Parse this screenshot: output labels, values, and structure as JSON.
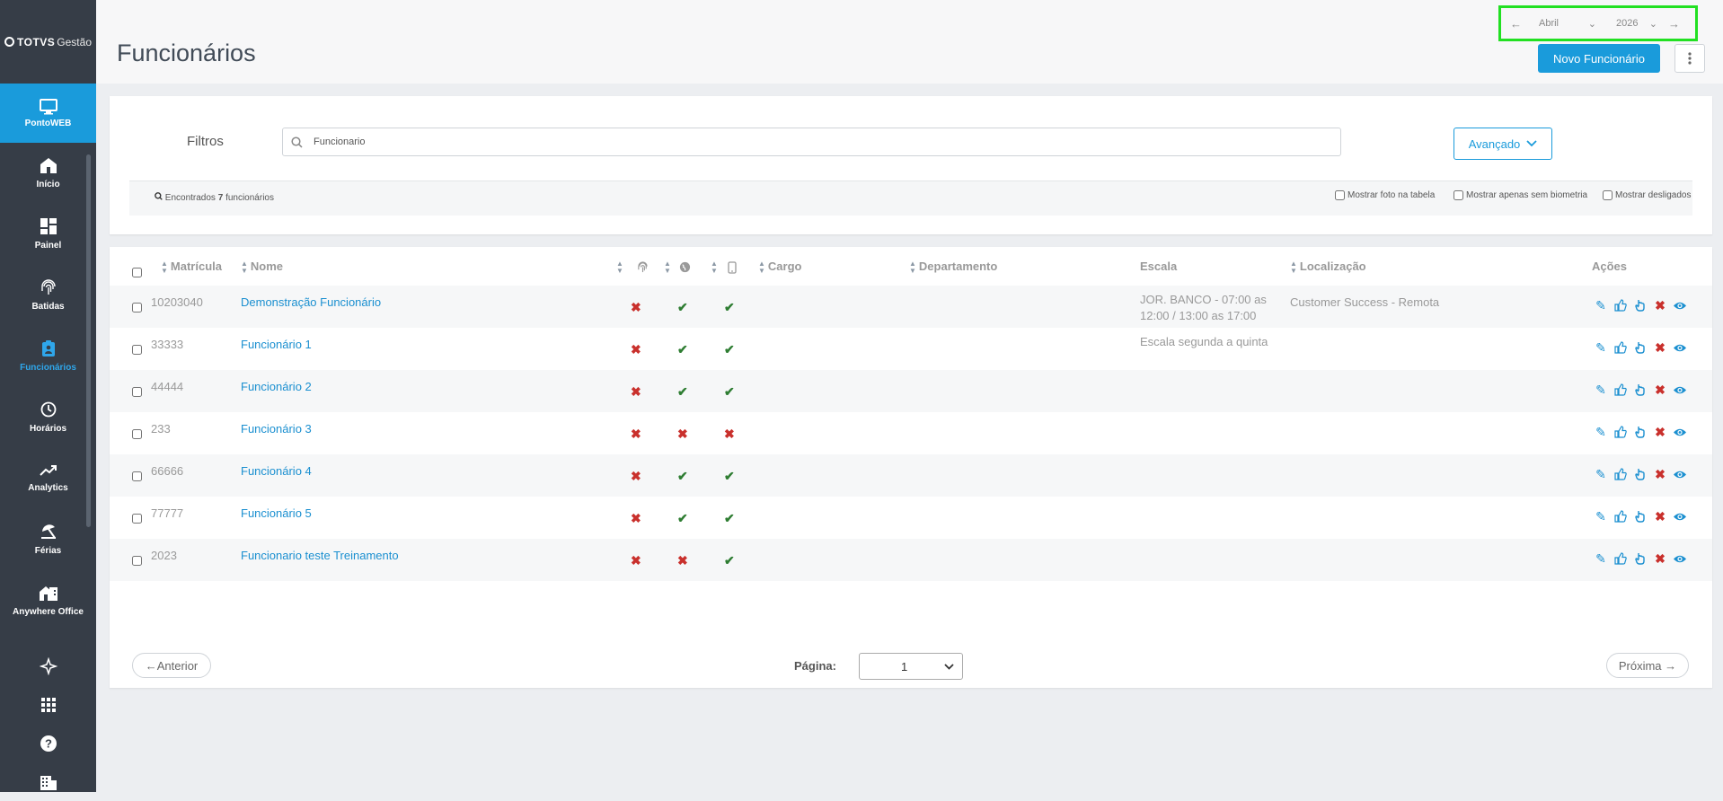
{
  "brand": {
    "logo": "TOTVS",
    "suffix": "Gestão"
  },
  "module": {
    "label": "PontoWEB",
    "icon": "monitor-icon"
  },
  "nav": [
    {
      "label": "Início",
      "icon": "home-icon"
    },
    {
      "label": "Painel",
      "icon": "dashboard-icon"
    },
    {
      "label": "Batidas",
      "icon": "fingerprint-icon"
    },
    {
      "label": "Funcionários",
      "icon": "badge-icon",
      "active": true
    },
    {
      "label": "Horários",
      "icon": "clock-icon"
    },
    {
      "label": "Analytics",
      "icon": "trend-icon"
    },
    {
      "label": "Férias",
      "icon": "umbrella-icon"
    },
    {
      "label": "Anywhere Office",
      "icon": "house-building-icon"
    }
  ],
  "bottom_icons": [
    "sparkle-icon",
    "apps-grid-icon",
    "help-icon",
    "building-icon"
  ],
  "header": {
    "title": "Funcionários",
    "month": "Abril",
    "year": "2026",
    "new_button": "Novo Funcionário"
  },
  "filters": {
    "label": "Filtros",
    "search_value": "Funcionario",
    "advanced": "Avançado",
    "found_prefix": "Encontrados",
    "found_count": "7",
    "found_suffix": "funcionários",
    "show_photo": "Mostrar foto na tabela",
    "no_biometry": "Mostrar apenas sem biometria",
    "show_dismissed": "Mostrar desligados"
  },
  "columns": {
    "matricula": "Matrícula",
    "nome": "Nome",
    "cargo": "Cargo",
    "departamento": "Departamento",
    "escala": "Escala",
    "localizacao": "Localização",
    "acoes": "Ações"
  },
  "rows": [
    {
      "matricula": "10203040",
      "nome": "Demonstração Funcionário",
      "bio": false,
      "web": true,
      "mobile": true,
      "escala_l1": "JOR. BANCO - 07:00 as",
      "escala_l2": "12:00 / 13:00 as 17:00",
      "localizacao": "Customer Success - Remota"
    },
    {
      "matricula": "33333",
      "nome": "Funcionário 1",
      "bio": false,
      "web": true,
      "mobile": true,
      "escala_l1": "Escala segunda a quinta",
      "escala_l2": "",
      "localizacao": ""
    },
    {
      "matricula": "44444",
      "nome": "Funcionário 2",
      "bio": false,
      "web": true,
      "mobile": true,
      "escala_l1": "",
      "escala_l2": "",
      "localizacao": ""
    },
    {
      "matricula": "233",
      "nome": "Funcionário 3",
      "bio": false,
      "web": false,
      "mobile": false,
      "escala_l1": "",
      "escala_l2": "",
      "localizacao": ""
    },
    {
      "matricula": "66666",
      "nome": "Funcionário 4",
      "bio": false,
      "web": true,
      "mobile": true,
      "escala_l1": "",
      "escala_l2": "",
      "localizacao": ""
    },
    {
      "matricula": "77777",
      "nome": "Funcionário 5",
      "bio": false,
      "web": true,
      "mobile": true,
      "escala_l1": "",
      "escala_l2": "",
      "localizacao": ""
    },
    {
      "matricula": "2023",
      "nome": "Funcionario teste Treinamento",
      "bio": false,
      "web": false,
      "mobile": true,
      "escala_l1": "",
      "escala_l2": "",
      "localizacao": ""
    }
  ],
  "pager": {
    "prev": "←Anterior",
    "label": "Página:",
    "page": "1",
    "next": "Próxima →"
  },
  "colors": {
    "accent": "#1a9bdb",
    "sidebar": "#363d47",
    "ok": "#2e7d32",
    "error": "#c9302c",
    "highlight": "#22e022"
  }
}
